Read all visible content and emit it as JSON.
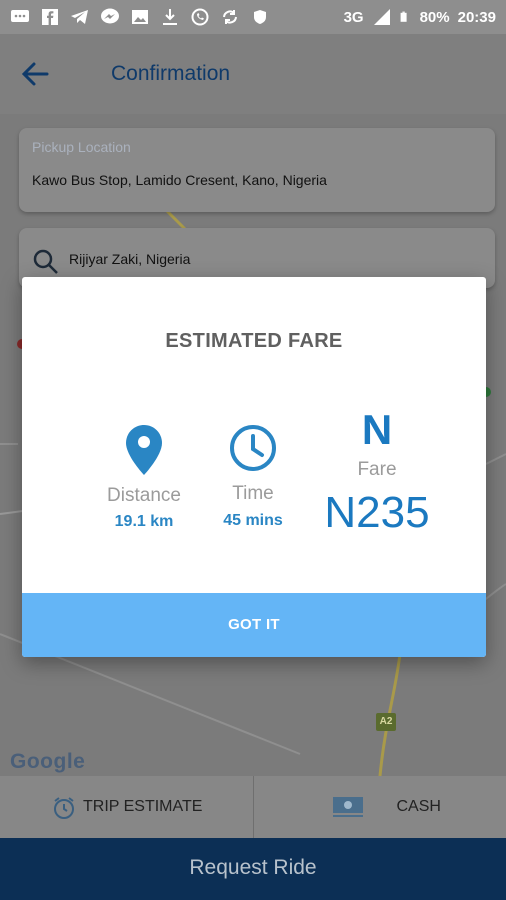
{
  "status_bar": {
    "network": "3G",
    "battery": "80%",
    "time": "20:39"
  },
  "header": {
    "title": "Confirmation",
    "back_icon": "arrow-left-icon"
  },
  "pickup": {
    "label": "Pickup Location",
    "value": "Kawo Bus Stop, Lamido Cresent, Kano, Nigeria"
  },
  "destination": {
    "value": "Rijiyar Zaki, Nigeria",
    "icon": "search-icon"
  },
  "map": {
    "attribution": "Google",
    "road_badge": "A2"
  },
  "modal": {
    "title": "ESTIMATED FARE",
    "distance": {
      "label": "Distance",
      "value": "19.1 km",
      "icon": "location-pin-icon"
    },
    "time": {
      "label": "Time",
      "value": "45 mins",
      "icon": "clock-icon"
    },
    "fare": {
      "symbol": "N",
      "label": "Fare",
      "value": "N235"
    },
    "button": "GOT IT",
    "accent": "#1b79c0",
    "button_color": "#64b5f6"
  },
  "options": {
    "trip_estimate": {
      "label": "TRIP ESTIMATE",
      "icon": "alarm-clock-icon"
    },
    "cash": {
      "label": "CASH",
      "icon": "cash-icon"
    }
  },
  "request_button": "Request Ride",
  "colors": {
    "primary_dark": "#0c2f55",
    "overlay_dim": "rgba(0,0,0,0.45)"
  }
}
